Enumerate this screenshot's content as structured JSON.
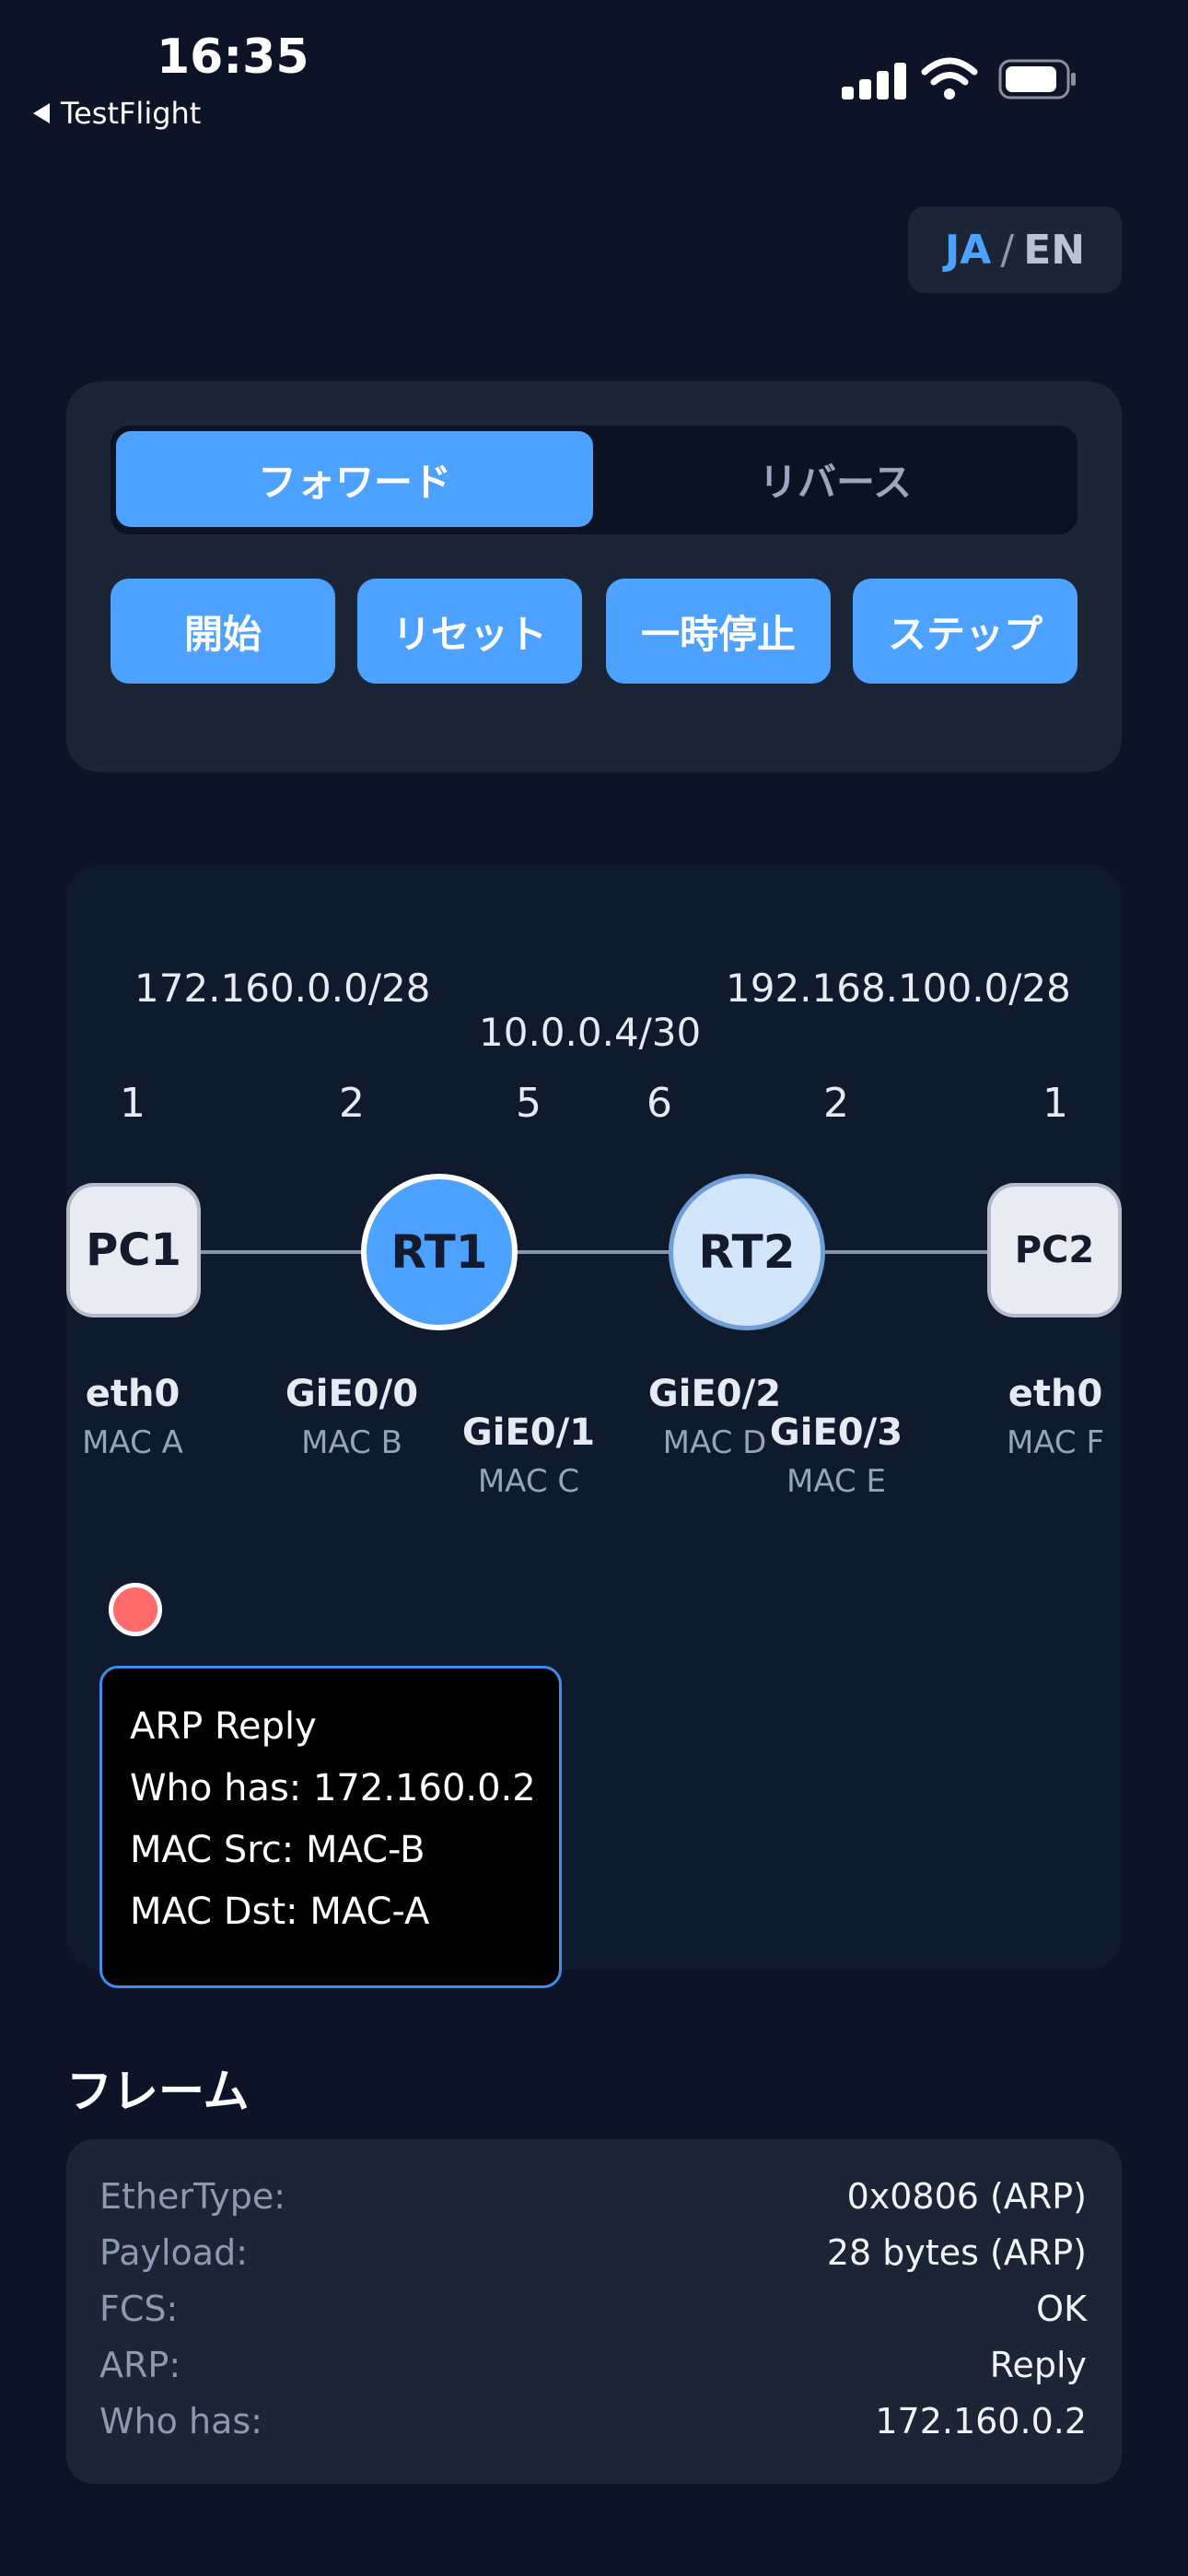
{
  "status_bar": {
    "time": "16:35",
    "back_label": "TestFlight",
    "icons": [
      "signal-icon",
      "wifi-icon",
      "battery-icon"
    ]
  },
  "lang": {
    "ja": "JA",
    "sep": "/",
    "en": "EN",
    "active": "JA"
  },
  "direction": {
    "forward": "フォワード",
    "reverse": "リバース",
    "selected": "forward"
  },
  "controls": {
    "start": "開始",
    "reset": "リセット",
    "pause": "一時停止",
    "step": "ステップ"
  },
  "topology": {
    "subnets": {
      "left": "172.160.0.0/28",
      "middle": "10.0.0.4/30",
      "right": "192.168.100.0/28"
    },
    "ports": {
      "pc1": "1",
      "rt1_left": "2",
      "rt1_right": "5",
      "rt2_left": "6",
      "rt2_right": "2",
      "pc2": "1"
    },
    "nodes": {
      "pc1": "PC1",
      "rt1": "RT1",
      "rt2": "RT2",
      "pc2": "PC2"
    },
    "interfaces": {
      "pc1": {
        "name": "eth0",
        "mac": "MAC A"
      },
      "rt1_left": {
        "name": "GiE0/0",
        "mac": "MAC B"
      },
      "rt1_right": {
        "name": "GiE0/1",
        "mac": "MAC C"
      },
      "rt2_left": {
        "name": "GiE0/2",
        "mac": "MAC D"
      },
      "rt2_right": {
        "name": "GiE0/3",
        "mac": "MAC E"
      },
      "pc2": {
        "name": "eth0",
        "mac": "MAC F"
      }
    }
  },
  "packet": {
    "line1": "ARP Reply",
    "line2": "Who has: 172.160.0.2",
    "line3": "MAC Src: MAC-B",
    "line4": "MAC Dst: MAC-A"
  },
  "frame": {
    "title": "フレーム",
    "rows": [
      {
        "key": "EtherType:",
        "value": "0x0806 (ARP)"
      },
      {
        "key": "Payload:",
        "value": "28 bytes (ARP)"
      },
      {
        "key": "FCS:",
        "value": "OK"
      },
      {
        "key": "ARP:",
        "value": "Reply"
      },
      {
        "key": "Who has:",
        "value": "172.160.0.2"
      }
    ]
  },
  "colors": {
    "accent": "#4ea2ff",
    "background": "#0d1427",
    "card": "#1b2536",
    "packet": "#ff6b6b"
  }
}
